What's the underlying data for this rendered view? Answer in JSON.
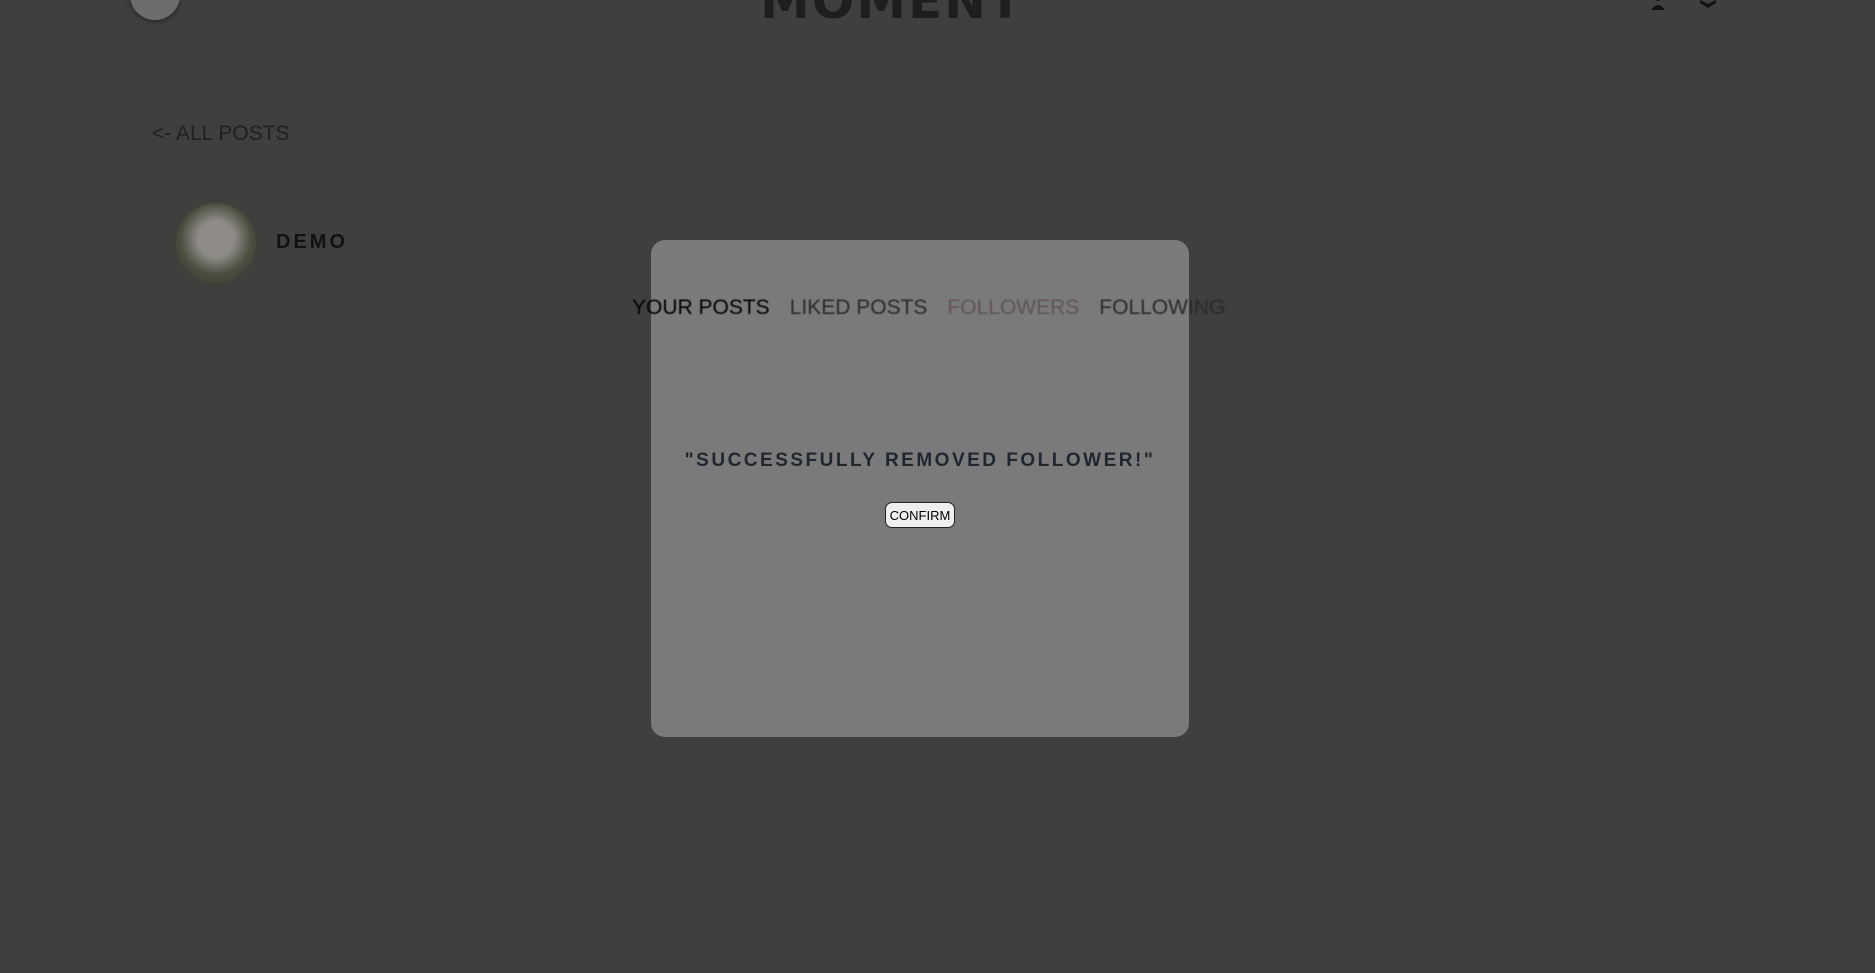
{
  "header": {
    "logo": "MOMENT",
    "icons": [
      "user-icon",
      "layers-icon"
    ]
  },
  "nav": {
    "back_label": "<- ALL POSTS"
  },
  "profile": {
    "username": "DEMO"
  },
  "tabs": [
    {
      "label": "YOUR POSTS"
    },
    {
      "label": "LIKED POSTS"
    },
    {
      "label": "FOLLOWERS",
      "active": true
    },
    {
      "label": "FOLLOWING"
    }
  ],
  "modal": {
    "message": "\"SUCCESSFULLY REMOVED FOLLOWER!\"",
    "confirm_label": "CONFIRM"
  },
  "colors": {
    "background": "#403f3d",
    "modal": "#7b7a7b",
    "message": "#1f2630"
  }
}
